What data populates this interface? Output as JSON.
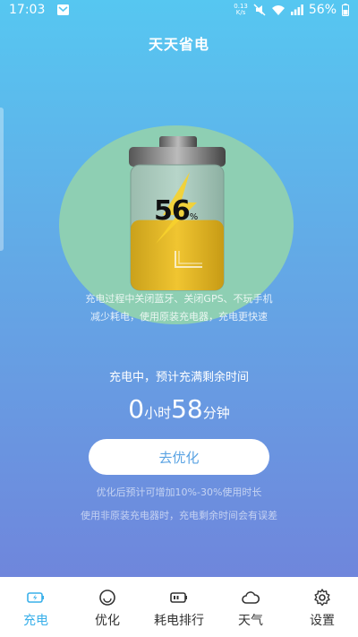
{
  "status_bar": {
    "time": "17:03",
    "net_speed_top": "0.13",
    "net_speed_bottom": "K/s",
    "battery": "56%"
  },
  "app": {
    "title": "天天省电"
  },
  "battery_display": {
    "level_percent": 56,
    "value": "56",
    "sign": "%"
  },
  "tips": {
    "line1": "充电过程中关闭蓝牙、关闭GPS、不玩手机",
    "line2": "减少耗电，使用原装充电器，充电更快速"
  },
  "charging": {
    "status": "充电中，预计充满剩余时间",
    "hours": "0",
    "hours_unit": "小时",
    "minutes": "58",
    "minutes_unit": "分钟"
  },
  "optimize_button": {
    "label": "去优化"
  },
  "notes": {
    "line1": "优化后预计可增加10%-30%使用时长",
    "line2": "使用非原装充电器时，充电剩余时间会有误差"
  },
  "tabs": [
    {
      "label": "充电",
      "icon": "battery-charging-icon",
      "active": true
    },
    {
      "label": "优化",
      "icon": "optimize-icon",
      "active": false
    },
    {
      "label": "耗电排行",
      "icon": "battery-rank-icon",
      "active": false
    },
    {
      "label": "天气",
      "icon": "cloud-icon",
      "active": false
    },
    {
      "label": "设置",
      "icon": "gear-icon",
      "active": false
    }
  ],
  "colors": {
    "accent": "#3ab0ea",
    "gradient_top": "#56c7f1",
    "gradient_bottom": "#6f86dc",
    "circle": "#8ecfb3",
    "battery_fill": "#e6b822"
  }
}
